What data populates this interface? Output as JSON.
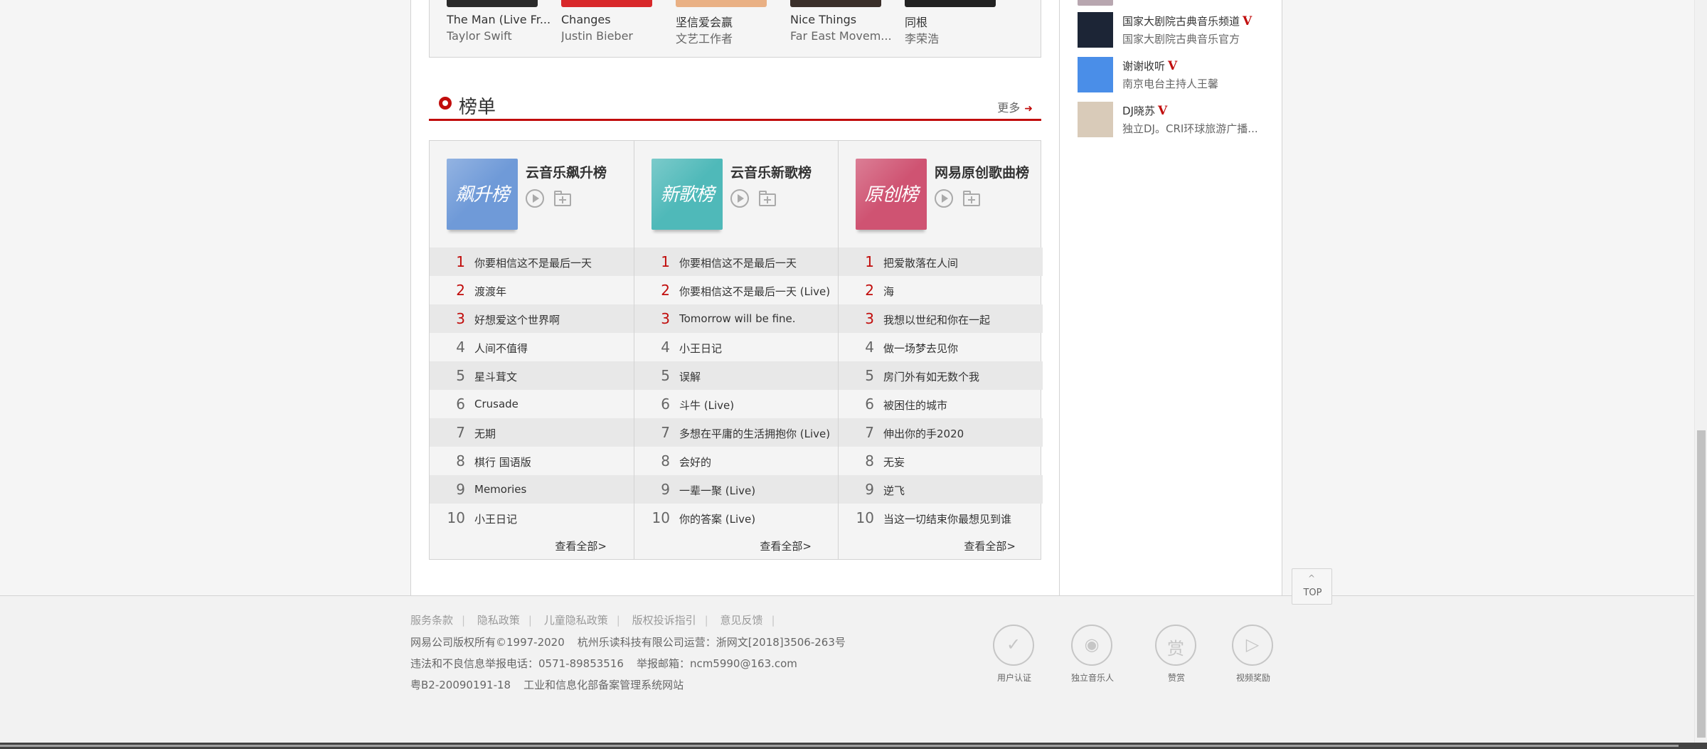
{
  "albums": [
    {
      "name": "The Man (Live Fr...",
      "artist": "Taylor Swift",
      "color": "#2a2a2a"
    },
    {
      "name": "Changes",
      "artist": "Justin Bieber",
      "color": "#d8282a"
    },
    {
      "name": "坚信爱会赢",
      "artist": "文艺工作者",
      "color": "#e9b084"
    },
    {
      "name": "Nice Things",
      "artist": "Far East Movem...",
      "color": "#3a2f2a"
    },
    {
      "name": "同根",
      "artist": "李荣浩",
      "color": "#222222"
    }
  ],
  "toplist": {
    "title": "榜单",
    "more": "更多"
  },
  "boards": [
    {
      "title": "云音乐飙升榜",
      "cover_text": "飙升榜",
      "cover_color": "#6f9ad8",
      "view_all": "查看全部>",
      "songs": [
        {
          "rank": "1",
          "name": "你要相信这不是最后一天"
        },
        {
          "rank": "2",
          "name": "渡渡年"
        },
        {
          "rank": "3",
          "name": "好想爱这个世界啊"
        },
        {
          "rank": "4",
          "name": "人间不值得"
        },
        {
          "rank": "5",
          "name": "星斗茸文"
        },
        {
          "rank": "6",
          "name": "Crusade"
        },
        {
          "rank": "7",
          "name": "无期"
        },
        {
          "rank": "8",
          "name": "棋行 国语版"
        },
        {
          "rank": "9",
          "name": "Memories"
        },
        {
          "rank": "10",
          "name": "小王日记"
        }
      ]
    },
    {
      "title": "云音乐新歌榜",
      "cover_text": "新歌榜",
      "cover_color": "#4fb9b9",
      "view_all": "查看全部>",
      "songs": [
        {
          "rank": "1",
          "name": "你要相信这不是最后一天"
        },
        {
          "rank": "2",
          "name": "你要相信这不是最后一天 (Live)"
        },
        {
          "rank": "3",
          "name": "Tomorrow will be fine."
        },
        {
          "rank": "4",
          "name": "小王日记"
        },
        {
          "rank": "5",
          "name": "误解"
        },
        {
          "rank": "6",
          "name": "斗牛 (Live)"
        },
        {
          "rank": "7",
          "name": "多想在平庸的生活拥抱你 (Live)"
        },
        {
          "rank": "8",
          "name": "会好的"
        },
        {
          "rank": "9",
          "name": "一辈一聚 (Live)"
        },
        {
          "rank": "10",
          "name": "你的答案 (Live)"
        }
      ]
    },
    {
      "title": "网易原创歌曲榜",
      "cover_text": "原创榜",
      "cover_color": "#cf5372",
      "view_all": "查看全部>",
      "songs": [
        {
          "rank": "1",
          "name": "把爱散落在人间"
        },
        {
          "rank": "2",
          "name": "海"
        },
        {
          "rank": "3",
          "name": "我想以世纪和你在一起"
        },
        {
          "rank": "4",
          "name": "做一场梦去见你"
        },
        {
          "rank": "5",
          "name": "房门外有如无数个我"
        },
        {
          "rank": "6",
          "name": "被困住的城市"
        },
        {
          "rank": "7",
          "name": "伸出你的手2020"
        },
        {
          "rank": "8",
          "name": "无妄"
        },
        {
          "rank": "9",
          "name": "逆飞"
        },
        {
          "rank": "10",
          "name": "当这一切结束你最想见到谁"
        }
      ]
    }
  ],
  "djs": [
    {
      "name": "国家大剧院古典音乐频道",
      "desc": "国家大剧院古典音乐官方",
      "verified": "V",
      "avatar_color": "#1c2536"
    },
    {
      "name": "谢谢收听",
      "desc": "南京电台主持人王馨",
      "verified": "V",
      "avatar_color": "#4a8ee8"
    },
    {
      "name": "DJ晓苏",
      "desc": "独立DJ。CRI环球旅游广播...",
      "verified": "V",
      "avatar_color": "#d9cbb9"
    }
  ],
  "top_button": {
    "caret": "^",
    "label": "TOP"
  },
  "footer": {
    "links": [
      "服务条款",
      "隐私政策",
      "儿童隐私政策",
      "版权投诉指引",
      "意见反馈"
    ],
    "separator": "|",
    "copyright": "网易公司版权所有©1997-2020",
    "operator": "杭州乐读科技有限公司运营：浙网文[2018]3506-263号",
    "report_phone": "违法和不良信息举报电话：0571-89853516",
    "report_email": "举报邮箱：ncm5990@163.com",
    "icp": "粤B2-20090191-18",
    "icp_link": "工业和信息化部备案管理系统网站",
    "badges": [
      {
        "label": "用户认证",
        "icon": "shield-check-icon",
        "glyph": "✓"
      },
      {
        "label": "独立音乐人",
        "icon": "vinyl-disc-icon",
        "glyph": "◉"
      },
      {
        "label": "赞赏",
        "icon": "reward-icon",
        "glyph": "赏"
      },
      {
        "label": "视频奖励",
        "icon": "video-play-icon",
        "glyph": "▷"
      }
    ]
  }
}
